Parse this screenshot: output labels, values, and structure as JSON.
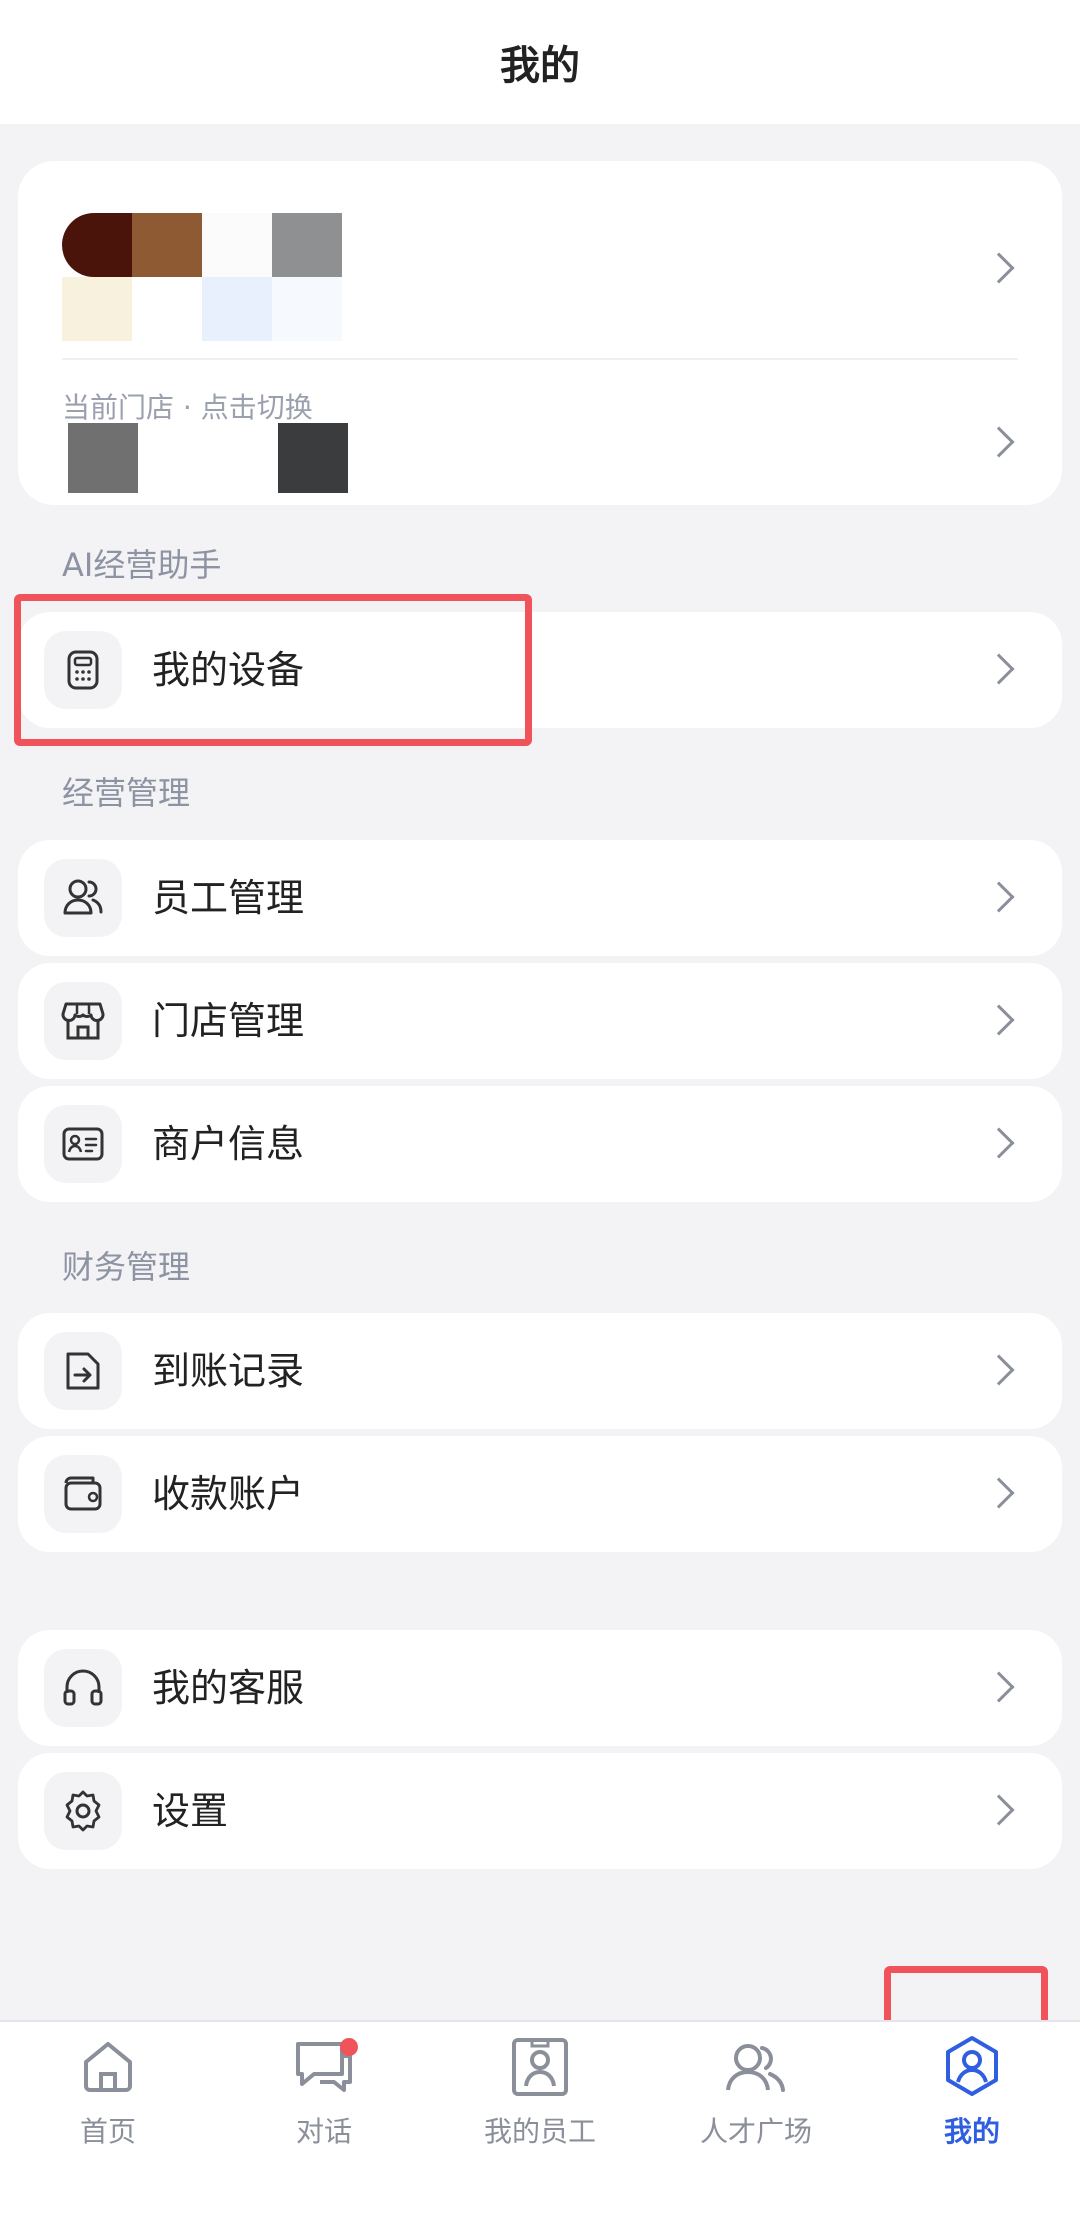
{
  "header": {
    "title": "我的"
  },
  "profile": {
    "store_label": "当前门店 · 点击切换"
  },
  "sections": {
    "ai": "AI经营助手",
    "business": "经营管理",
    "finance": "财务管理"
  },
  "menu": {
    "devices": "我的设备",
    "staff": "员工管理",
    "stores": "门店管理",
    "merchant": "商户信息",
    "arrivals": "到账记录",
    "accounts": "收款账户",
    "service": "我的客服",
    "settings": "设置"
  },
  "tabs": [
    {
      "label": "首页",
      "icon": "home-icon"
    },
    {
      "label": "对话",
      "icon": "chat-icon"
    },
    {
      "label": "我的员工",
      "icon": "employee-badge-icon"
    },
    {
      "label": "人才广场",
      "icon": "talent-icon"
    },
    {
      "label": "我的",
      "icon": "user-icon"
    }
  ],
  "colors": {
    "accent": "#2f5fe0",
    "highlight": "#f0545a",
    "badge": "#f0545a"
  }
}
